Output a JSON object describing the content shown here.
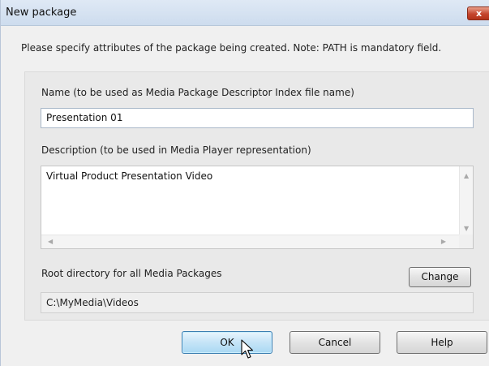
{
  "dialog": {
    "title": "New package",
    "close_label": "x",
    "instruction": "Please specify attributes of the package being created. Note: PATH is mandatory field."
  },
  "form": {
    "name_label": "Name (to be used as Media Package Descriptor Index file name)",
    "name_value": "Presentation 01",
    "description_label": "Description (to be used in Media Player representation)",
    "description_value": "Virtual Product Presentation Video",
    "root_label": "Root directory for all Media Packages",
    "root_value": "C:\\MyMedia\\Videos",
    "change_label": "Change"
  },
  "buttons": {
    "ok": "OK",
    "cancel": "Cancel",
    "help": "Help"
  },
  "icons": {
    "close": "close-icon",
    "cursor": "mouse-pointer-icon",
    "scroll_up": "scroll-up-arrow-icon",
    "scroll_down": "scroll-down-arrow-icon",
    "scroll_left": "scroll-left-arrow-icon",
    "scroll_right": "scroll-right-arrow-icon"
  },
  "colors": {
    "titlebar": "#cddcee",
    "close_button": "#c5452d",
    "default_button": "#c5e4f7"
  }
}
